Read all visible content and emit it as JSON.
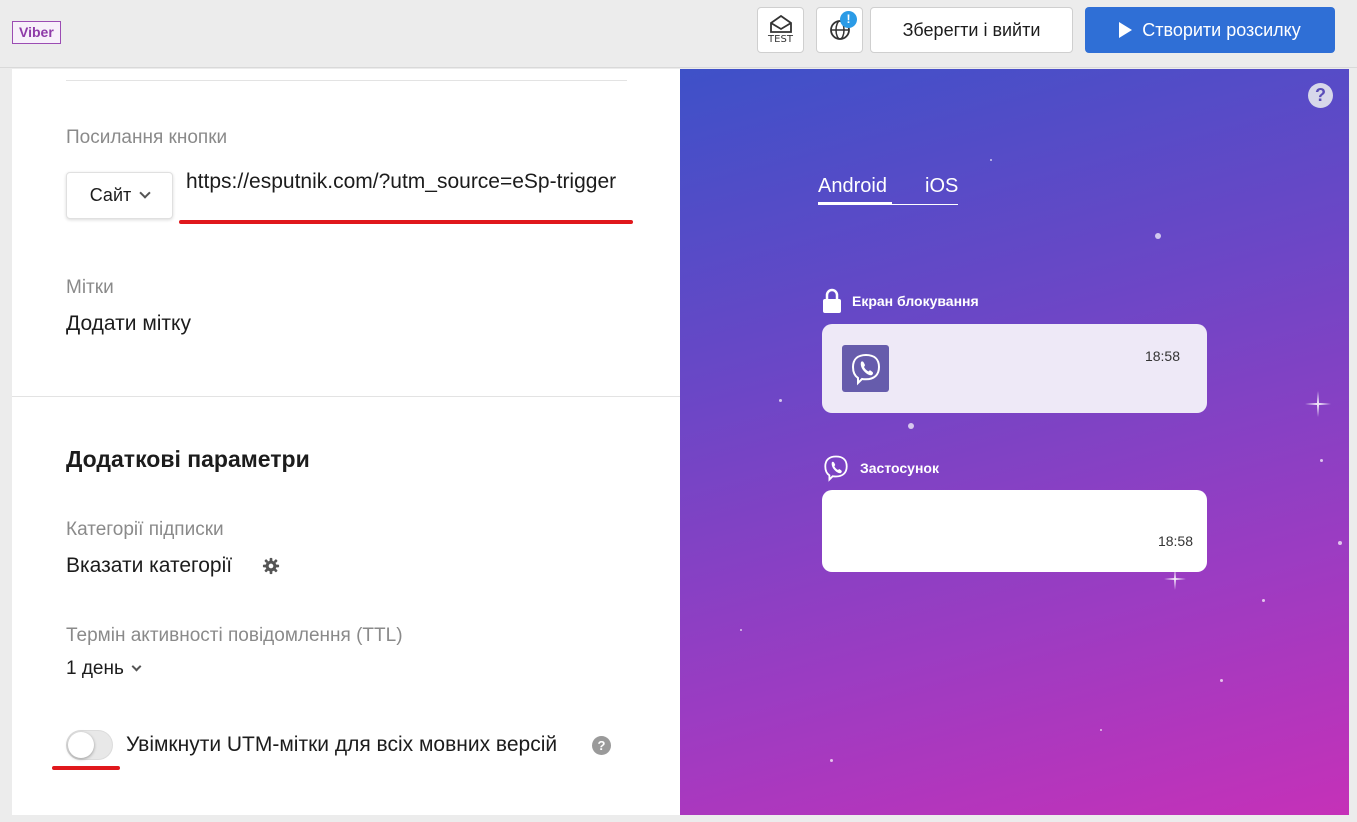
{
  "header": {
    "channel_badge": "Viber",
    "test_button_label": "TEST",
    "globe_alert": "!",
    "save_exit_label": "Зберегти і вийти",
    "create_label": "Створити розсилку"
  },
  "form": {
    "button_link_label": "Посилання кнопки",
    "link_type": "Сайт",
    "url_value": "https://esputnik.com/?utm_source=eSp-trigger",
    "tags_label": "Мітки",
    "add_tag": "Додати мітку",
    "additional_title": "Додаткові параметри",
    "categories_label": "Категорії підписки",
    "categories_action": "Вказати категорії",
    "ttl_label": "Термін активності повідомлення (TTL)",
    "ttl_value": "1 день",
    "utm_toggle_label": "Увімкнути UTM-мітки для всіх мовних версій",
    "utm_toggle_on": false
  },
  "preview": {
    "tabs": [
      "Android",
      "iOS"
    ],
    "active_tab": "Android",
    "lock_screen_caption": "Екран блокування",
    "lock_time": "18:58",
    "app_caption": "Застосунок",
    "app_time": "18:58",
    "colors": {
      "gradient_start": "#3e51c8",
      "gradient_end": "#c531b8",
      "viber_purple": "#665cac"
    }
  },
  "colors": {
    "primary": "#2f6fd6",
    "highlight_red": "#e0181c",
    "badge_purple": "#8e3aa8"
  }
}
